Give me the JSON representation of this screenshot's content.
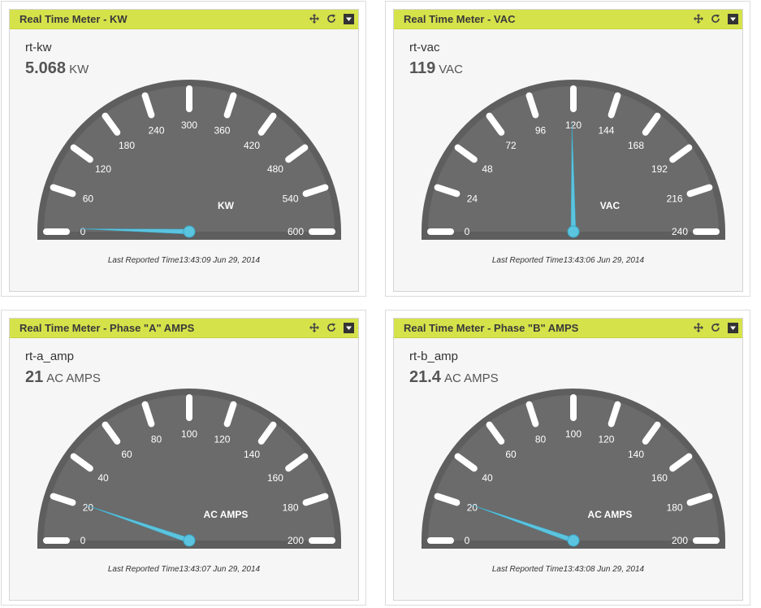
{
  "widgets": [
    {
      "title": "Real Time Meter - KW",
      "metric_name": "rt-kw",
      "value": "5.068",
      "unit": "KW",
      "gauge_label": "KW",
      "ticks": [
        "0",
        "60",
        "120",
        "180",
        "240",
        "300",
        "360",
        "420",
        "480",
        "540",
        "600"
      ],
      "min": 0,
      "max": 600,
      "reading": 5.068,
      "footer": "Last Reported Time13:43:09 Jun 29, 2014"
    },
    {
      "title": "Real Time Meter - VAC",
      "metric_name": "rt-vac",
      "value": "119",
      "unit": "VAC",
      "gauge_label": "VAC",
      "ticks": [
        "0",
        "24",
        "48",
        "72",
        "96",
        "120",
        "144",
        "168",
        "192",
        "216",
        "240"
      ],
      "min": 0,
      "max": 240,
      "reading": 119,
      "footer": "Last Reported Time13:43:06 Jun 29, 2014"
    },
    {
      "title": "Real Time Meter - Phase \"A\" AMPS",
      "metric_name": "rt-a_amp",
      "value": "21",
      "unit": "AC AMPS",
      "gauge_label": "AC AMPS",
      "ticks": [
        "0",
        "20",
        "40",
        "60",
        "80",
        "100",
        "120",
        "140",
        "160",
        "180",
        "200"
      ],
      "min": 0,
      "max": 200,
      "reading": 21,
      "footer": "Last Reported Time13:43:07 Jun 29, 2014"
    },
    {
      "title": "Real Time Meter - Phase \"B\" AMPS",
      "metric_name": "rt-b_amp",
      "value": "21.4",
      "unit": "AC AMPS",
      "gauge_label": "AC AMPS",
      "ticks": [
        "0",
        "20",
        "40",
        "60",
        "80",
        "100",
        "120",
        "140",
        "160",
        "180",
        "200"
      ],
      "min": 0,
      "max": 200,
      "reading": 21.4,
      "footer": "Last Reported Time13:43:08 Jun 29, 2014"
    }
  ],
  "icons": {
    "move": "move-arrows-icon",
    "refresh": "refresh-icon",
    "menu": "dropdown-menu-icon"
  },
  "colors": {
    "header": "#d6e24a",
    "gauge_face": "#6a6a6a",
    "needle": "#5bc4df",
    "tick_marks": "#ffffff"
  }
}
